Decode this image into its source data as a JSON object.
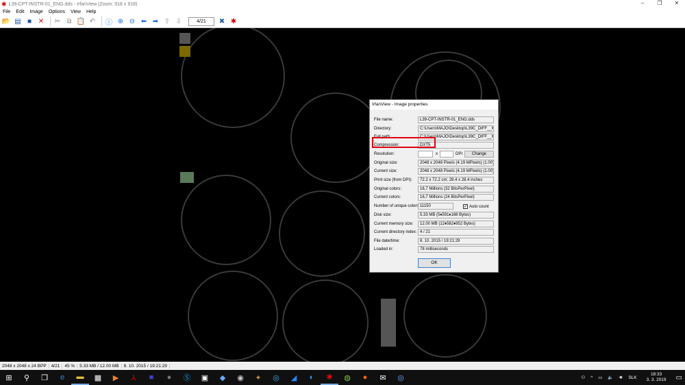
{
  "window": {
    "title": "L39-CPT-INSTR-01_ENG.dds - IrfanView (Zoom: 918 x 918)"
  },
  "menu": [
    "File",
    "Edit",
    "Image",
    "Options",
    "View",
    "Help"
  ],
  "toolbar": {
    "page": "4/21",
    "icons": [
      "open-icon",
      "thumbnails-icon",
      "save-icon",
      "delete-icon",
      "cut-icon",
      "copy-icon",
      "paste-icon",
      "undo-icon",
      "info-icon",
      "zoom-in-icon",
      "zoom-out-icon",
      "previous-icon",
      "next-icon",
      "page-up-icon",
      "page-down-icon",
      "settings-icon",
      "irfanview-icon"
    ]
  },
  "dialog": {
    "title": "IrfanView - Image properties",
    "rows": [
      {
        "label": "File name:",
        "value": "L39-CPT-INSTR-01_ENG.dds"
      },
      {
        "label": "Directory:",
        "value": "C:\\Users\\MAJO\\Desktop\\L39C_DIFF__MA"
      },
      {
        "label": "Full path:",
        "value": "C:\\Users\\MAJO\\Desktop\\L39C_DIFF__MA"
      },
      {
        "label": "Compression:",
        "value": "DXT5"
      },
      {
        "label": "Resolution:",
        "value": ""
      },
      {
        "label": "Original size:",
        "value": "2048 x 2048  Pixels (4.19 MPixels) (1.00)"
      },
      {
        "label": "Current size:",
        "value": "2048 x 2048  Pixels (4.19 MPixels) (1.00)"
      },
      {
        "label": "Print size (from DPI):",
        "value": "72.2 x 72.2 cm; 28.4 x 28.4 inches"
      },
      {
        "label": "Original colors:",
        "value": "16,7 Millions   (32 BitsPerPixel)"
      },
      {
        "label": "Current colors:",
        "value": "16,7 Millions   (24 BitsPerPixel)"
      },
      {
        "label": "Number of unique colors:",
        "value": "11150"
      },
      {
        "label": "Disk size:",
        "value": "5.33 MB (5♦591♦168 Bytes)"
      },
      {
        "label": "Current memory size:",
        "value": "12.00  MB (12♦582♦952 Bytes)"
      },
      {
        "label": "Current directory index:",
        "value": "4  /  21"
      },
      {
        "label": "File date/time:",
        "value": "8. 10. 2015 / 19:21:29"
      },
      {
        "label": "Loaded in:",
        "value": "78 milliseconds"
      }
    ],
    "resolution_x_sep": "x",
    "dpi_label": "DPI",
    "change_label": "Change",
    "auto_count_label": "Auto count",
    "auto_count_checked": true,
    "ok_label": "OK"
  },
  "status": [
    "2048 x 2048 x 24 BPP",
    "4/21",
    "45 %",
    "5.33 MB / 12.00 MB",
    "8. 10. 2015 / 19:21:29"
  ],
  "tray": {
    "language": "SLK",
    "time": "18:33",
    "date": "3. 3. 2019"
  }
}
